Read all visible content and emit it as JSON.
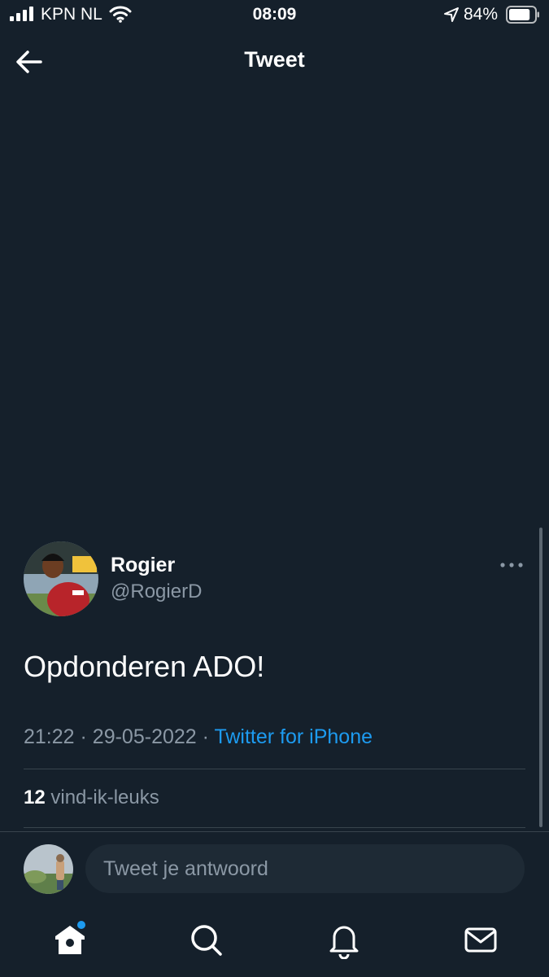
{
  "status_bar": {
    "carrier": "KPN NL",
    "time": "08:09",
    "battery_percent": "84%",
    "battery_level": 0.84,
    "icons": [
      "signal-icon",
      "wifi-icon",
      "location-arrow-icon",
      "battery-icon"
    ]
  },
  "nav": {
    "title": "Tweet",
    "back_icon": "arrow-left-icon"
  },
  "tweet": {
    "author_name": "Rogier",
    "author_handle": "@RogierD",
    "text": "Opdonderen ADO!",
    "time": "21:22",
    "date": "29-05-2022",
    "separator": "·",
    "source": "Twitter for iPhone",
    "like_count": "12",
    "like_label": "vind-ik-leuks",
    "more_icon": "more-horizontal-icon"
  },
  "reply": {
    "placeholder": "Tweet je antwoord"
  },
  "tab_bar": {
    "tabs": [
      {
        "icon": "home-icon",
        "active": true,
        "has_notification_dot": true
      },
      {
        "icon": "search-icon",
        "active": false
      },
      {
        "icon": "bell-icon",
        "active": false
      },
      {
        "icon": "mail-icon",
        "active": false
      }
    ]
  },
  "colors": {
    "background": "#15202b",
    "accent": "#1d9bf0",
    "secondary_text": "#8b98a5",
    "divider": "#38444d",
    "reply_field": "#1e2a35"
  }
}
